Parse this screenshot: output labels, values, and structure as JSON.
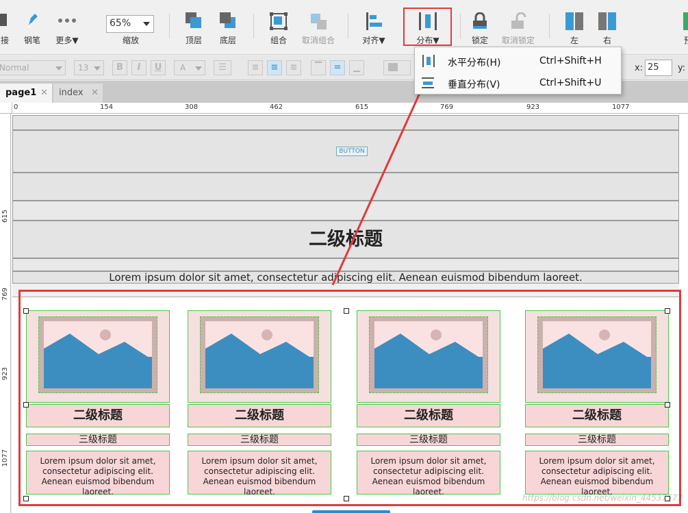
{
  "toolbar": {
    "items": [
      {
        "label": "接",
        "icon": "connect-icon"
      },
      {
        "label": "钢笔",
        "icon": "pen-icon"
      },
      {
        "label": "更多▼",
        "icon": "more-icon"
      },
      {
        "label": "缩放",
        "icon": "zoom-icon"
      },
      {
        "label": "顶层",
        "icon": "bring-front-icon"
      },
      {
        "label": "底层",
        "icon": "send-back-icon"
      },
      {
        "label": "组合",
        "icon": "group-icon"
      },
      {
        "label": "取消组合",
        "icon": "ungroup-icon"
      },
      {
        "label": "对齐▼",
        "icon": "align-icon"
      },
      {
        "label": "分布▼",
        "icon": "distribute-icon"
      },
      {
        "label": "锁定",
        "icon": "lock-icon"
      },
      {
        "label": "取消锁定",
        "icon": "unlock-icon"
      },
      {
        "label": "左",
        "icon": "left-icon"
      },
      {
        "label": "右",
        "icon": "right-icon"
      },
      {
        "label": "预",
        "icon": "preview-icon"
      }
    ],
    "zoom_value": "65%"
  },
  "formatbar": {
    "style_value": "Normal",
    "font_size": "13",
    "x_label": "x:",
    "x_value": "25",
    "y_label": "y:"
  },
  "tabs": [
    {
      "label": "page1",
      "close": "✕"
    },
    {
      "label": "index",
      "close": "✕"
    }
  ],
  "ruler": {
    "h_ticks": [
      "0",
      "154",
      "308",
      "462",
      "615",
      "769",
      "923",
      "1077"
    ],
    "v_ticks": [
      "615",
      "769",
      "923",
      "1077"
    ]
  },
  "canvas": {
    "button_text": "BUTTON",
    "heading": "二级标题",
    "lorem": "Lorem ipsum dolor sit amet, consectetur adipiscing elit. Aenean euismod bibendum laoreet."
  },
  "cards": [
    {
      "h2": "二级标题",
      "h3": "三级标题",
      "text": "Lorem ipsum dolor sit amet, consectetur adipiscing elit. Aenean euismod bibendum laoreet."
    },
    {
      "h2": "二级标题",
      "h3": "三级标题",
      "text": "Lorem ipsum dolor sit amet, consectetur adipiscing elit. Aenean euismod bibendum laoreet."
    },
    {
      "h2": "二级标题",
      "h3": "三级标题",
      "text": "Lorem ipsum dolor sit amet, consectetur adipiscing elit. Aenean euismod bibendum laoreet."
    },
    {
      "h2": "二级标题",
      "h3": "三级标题",
      "text": "Lorem ipsum dolor sit amet, consectetur adipiscing elit. Aenean euismod bibendum laoreet."
    }
  ],
  "menu": {
    "items": [
      {
        "label": "水平分布(H)",
        "shortcut": "Ctrl+Shift+H",
        "icon": "horizontal-distribute-icon"
      },
      {
        "label": "垂直分布(V)",
        "shortcut": "Ctrl+Shift+U",
        "icon": "vertical-distribute-icon"
      }
    ]
  },
  "watermark": "https://blog.csdn.net/weixin_44537577",
  "colors": {
    "accent": "#2b8ccc",
    "highlight": "#e03a3a",
    "selection": "#44cc44"
  }
}
